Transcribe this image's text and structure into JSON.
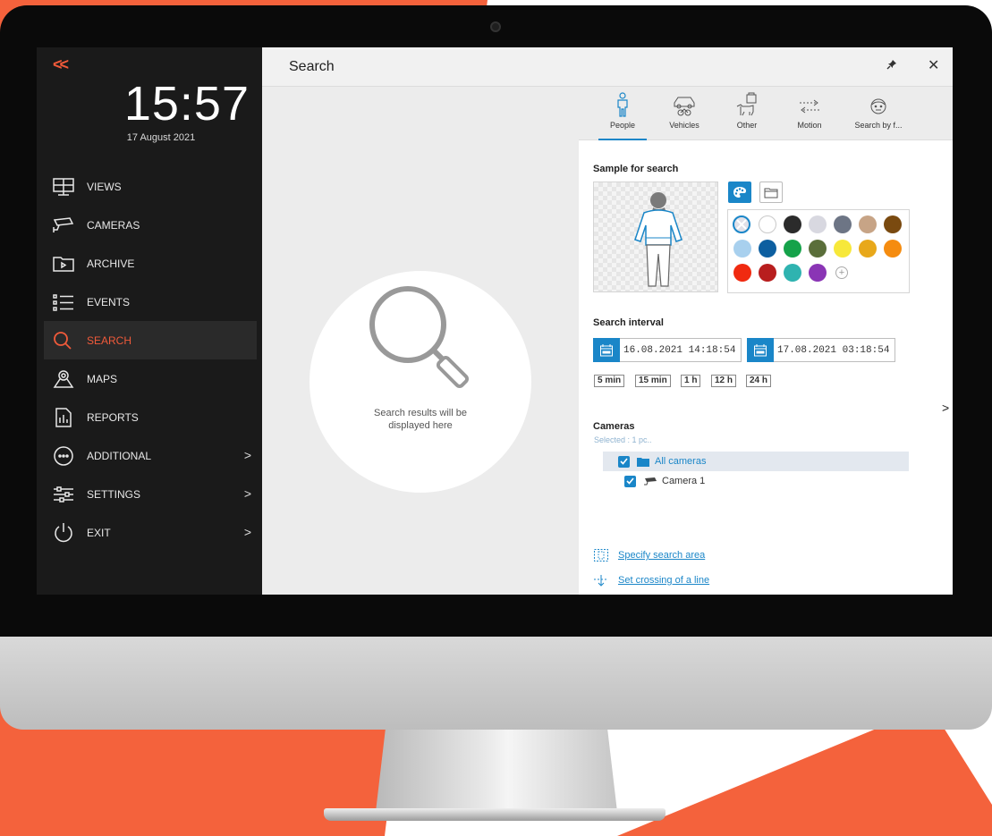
{
  "colors": {
    "accent": "#f05a3a",
    "primary": "#1a86c8",
    "sidebar_bg": "#1a1a1a"
  },
  "sidebar": {
    "collapse_label": "<<",
    "time": "15:57",
    "date": "17 August 2021",
    "items": [
      {
        "label": "VIEWS",
        "icon": "views-icon"
      },
      {
        "label": "CAMERAS",
        "icon": "camera-icon"
      },
      {
        "label": "ARCHIVE",
        "icon": "archive-icon"
      },
      {
        "label": "EVENTS",
        "icon": "events-icon"
      },
      {
        "label": "SEARCH",
        "icon": "search-icon",
        "active": true
      },
      {
        "label": "MAPS",
        "icon": "map-icon"
      },
      {
        "label": "REPORTS",
        "icon": "report-icon"
      },
      {
        "label": "ADDITIONAL",
        "icon": "more-icon",
        "submenu": true
      },
      {
        "label": "SETTINGS",
        "icon": "settings-sliders-icon",
        "submenu": true
      },
      {
        "label": "EXIT",
        "icon": "power-icon",
        "submenu": true
      }
    ],
    "chevron": ">"
  },
  "header": {
    "title": "Search",
    "close": "✕"
  },
  "results": {
    "line1": "Search results will be",
    "line2": "displayed here"
  },
  "tabs": [
    {
      "label": "People",
      "icon": "person-icon",
      "active": true
    },
    {
      "label": "Vehicles",
      "icon": "vehicles-icon"
    },
    {
      "label": "Other",
      "icon": "other-icon"
    },
    {
      "label": "Motion",
      "icon": "motion-icon"
    },
    {
      "label": "Search by f...",
      "icon": "face-icon"
    }
  ],
  "sample": {
    "title": "Sample for search"
  },
  "palette": [
    "none",
    "#ffffff",
    "#2b2b2b",
    "#d8d8e0",
    "#6d7585",
    "#c7a486",
    "#7a4a10",
    "#a8d0ee",
    "#0d5fa0",
    "#15a24a",
    "#5a6e3a",
    "#f7e83a",
    "#e8a81a",
    "#f58c10",
    "#f02a10",
    "#b81e1e",
    "#2fb3b0",
    "#8a35b5",
    "+"
  ],
  "interval": {
    "title": "Search interval",
    "from": "16.08.2021  14:18:54",
    "to": "17.08.2021  03:18:54",
    "quick": [
      "5 min",
      "15 min",
      "1 h",
      "12 h",
      "24 h"
    ]
  },
  "cameras": {
    "title": "Cameras",
    "selected": "Selected : 1 pc..",
    "group": "All cameras",
    "camera": "Camera 1"
  },
  "links": {
    "area": "Specify search area",
    "line": "Set crossing of a line"
  },
  "expand": ">"
}
